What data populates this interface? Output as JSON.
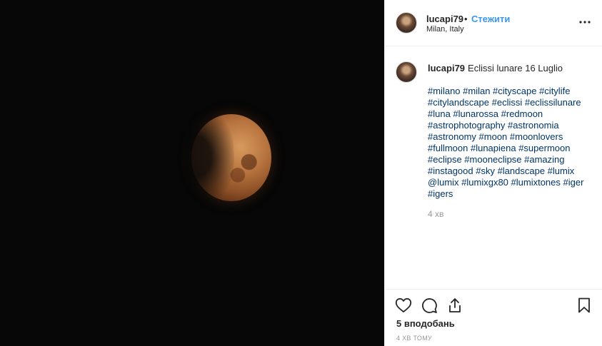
{
  "header": {
    "username": "lucapi79",
    "dot": "•",
    "follow_label": "Стежити",
    "location": "Milan, Italy",
    "more_icon": "more-horizontal-icon"
  },
  "caption": {
    "username": "lucapi79",
    "text": "Eclissi lunare 16 Luglio",
    "hashtags": "#milano #milan #cityscape #citylife #citylandscape #eclissi #eclissilunare #luna #lunarossa #redmoon #astrophotography #astronomia #astronomy #moon #moonlovers #fullmoon #lunapiena #supermoon #eclipse #mooneclipse #amazing #instagood #sky #landscape #lumix @lumix #lumixgx80 #lumixtones #iger #igers",
    "time": "4 хв"
  },
  "actions": {
    "like_icon": "heart-icon",
    "comment_icon": "comment-icon",
    "share_icon": "share-icon",
    "save_icon": "bookmark-icon",
    "likes": "5 вподобань",
    "timestamp": "4 ХВ ТОМУ"
  }
}
